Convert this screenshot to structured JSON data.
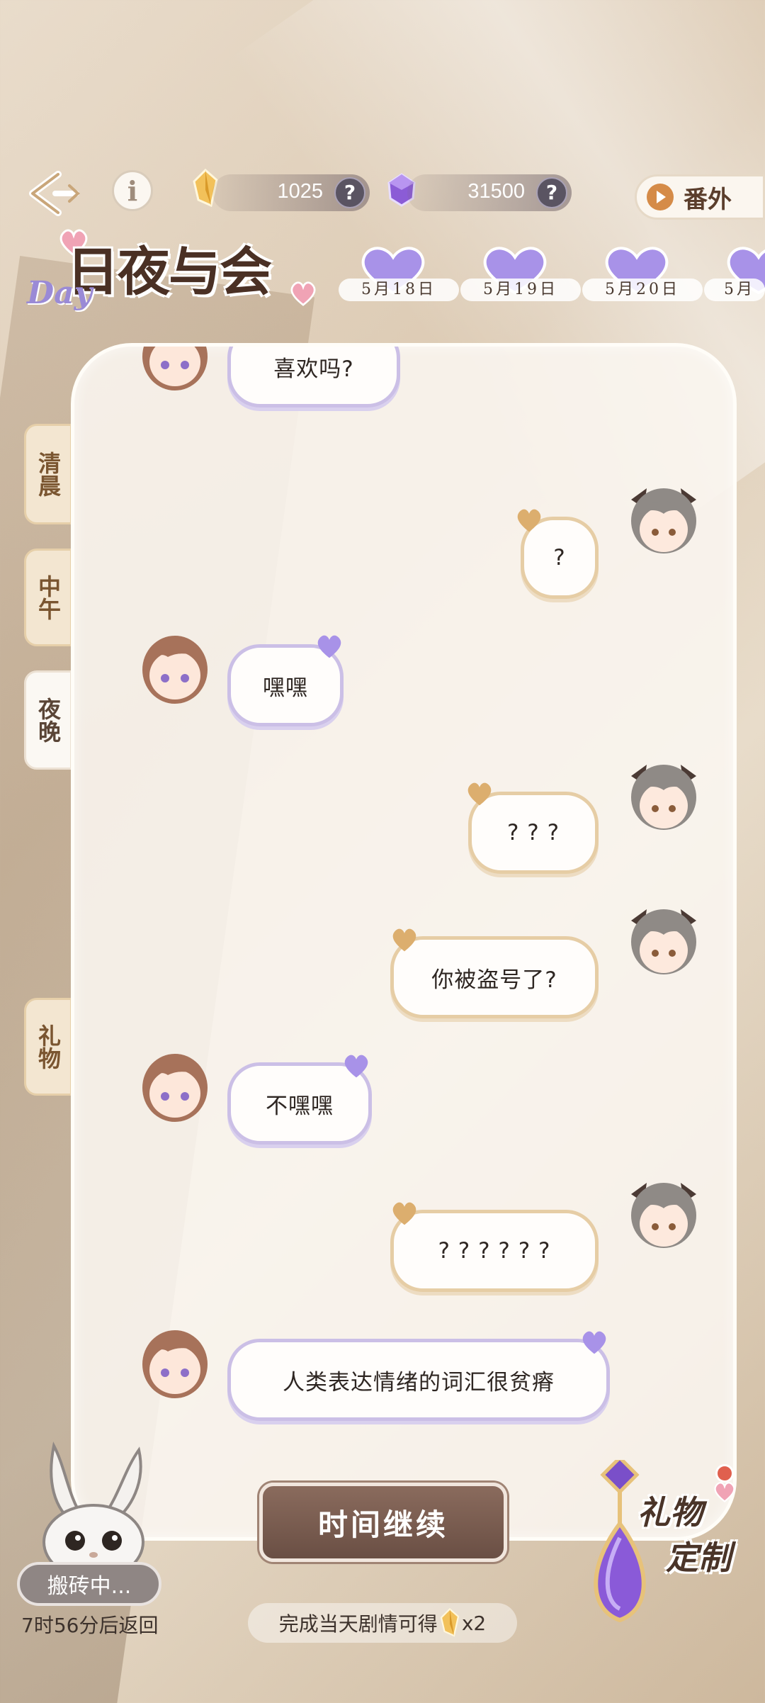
{
  "top_bar": {
    "gold_amount": "1025",
    "purple_amount": "31500",
    "help_symbol": "?",
    "info_symbol": "i",
    "extra_label": "番外"
  },
  "title": {
    "main": "日夜与会",
    "accent": "Day"
  },
  "dates": [
    "5月18日",
    "5月19日",
    "5月20日",
    "5月"
  ],
  "side_tabs": {
    "morning": "清晨",
    "noon": "中午",
    "night": "夜晚",
    "gift": "礼物"
  },
  "messages": [
    {
      "side": "left",
      "text": "喜欢吗?"
    },
    {
      "side": "right",
      "text": "?"
    },
    {
      "side": "left",
      "text": "嘿嘿"
    },
    {
      "side": "right",
      "text": "? ? ?"
    },
    {
      "side": "right",
      "text": "你被盗号了?"
    },
    {
      "side": "left",
      "text": "不嘿嘿"
    },
    {
      "side": "right",
      "text": "? ? ? ? ? ?"
    },
    {
      "side": "left",
      "text": "人类表达情绪的词汇很贫瘠"
    }
  ],
  "bottom": {
    "continue_label": "时间继续",
    "reward_text": "完成当天剧情可得",
    "reward_suffix": "x2",
    "busy_label": "搬砖中...",
    "return_text": "7时56分后返回",
    "gift_custom_line1": "礼物",
    "gift_custom_line2": "定制"
  },
  "colors": {
    "left_bubble_border": "#cbbfe6",
    "right_bubble_border": "#e6cda5",
    "accent_purple": "#9a8ad6",
    "button_brown": "#6a4f44"
  },
  "icons": {
    "back": "back-arrow-icon",
    "info": "info-icon",
    "gold": "gold-crystal-icon",
    "purple": "purple-gem-icon",
    "heart": "heart-icon"
  }
}
